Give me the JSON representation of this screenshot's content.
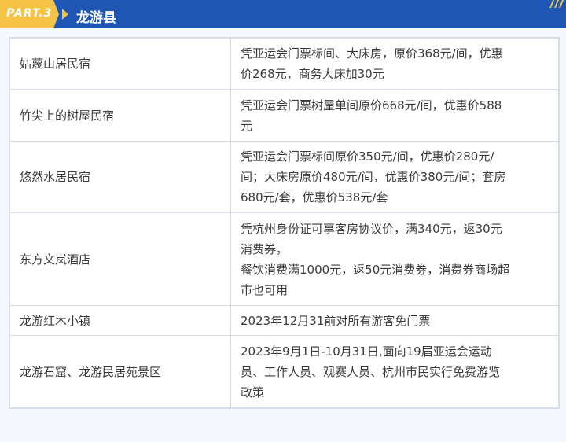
{
  "header": {
    "part_label": "PART.3",
    "region_title": "龙游县",
    "accent_color": "#f6c445",
    "brand_color": "#1f56b3",
    "deco_icon": "slash-stripes-icon"
  },
  "table": {
    "rows": [
      {
        "name": "姑蔑山居民宿",
        "lines": [
          "凭亚运会门票标间、大床房，原价368元/间，优惠",
          "价268元，商务大床加30元"
        ]
      },
      {
        "name": "竹尖上的树屋民宿",
        "lines": [
          "凭亚运会门票树屋单间原价668元/间，优惠价588",
          "元"
        ]
      },
      {
        "name": "悠然水居民宿",
        "lines": [
          "凭亚运会门票标间原价350元/间，优惠价280元/",
          "间；大床房原价480元/间，优惠价380元/间；套房",
          "680元/套，优惠价538元/套"
        ]
      },
      {
        "name": "东方文岚酒店",
        "lines": [
          "凭杭州身份证可享客房协议价，满340元，返30元",
          "消费券，",
          "餐饮消费满1000元，返50元消费券，消费券商场超",
          "市也可用"
        ]
      },
      {
        "name": "龙游红木小镇",
        "lines": [
          "2023年12月31前对所有游客免门票"
        ]
      },
      {
        "name": "龙游石窟、龙游民居苑景区",
        "lines": [
          "2023年9月1日-10月31日,面向19届亚运会运动",
          "员、工作人员、观赛人员、杭州市民实行免费游览",
          "政策"
        ]
      }
    ]
  }
}
